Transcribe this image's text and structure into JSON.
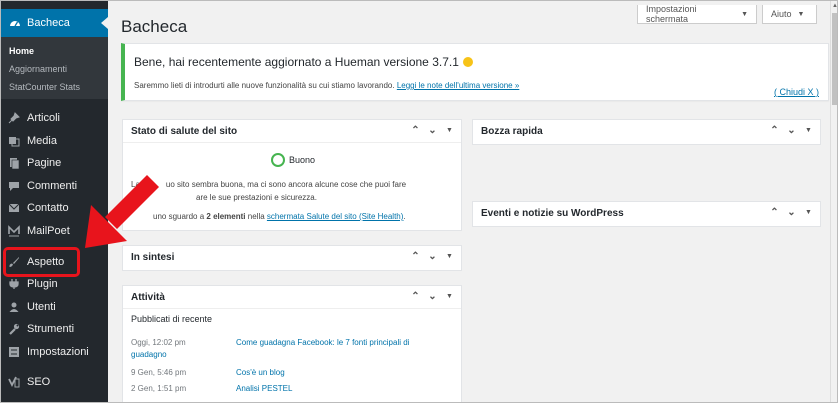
{
  "sidebar": {
    "active": {
      "label": "Bacheca",
      "icon": "dashboard-icon"
    },
    "submenu": [
      "Home",
      "Aggiornamenti",
      "StatCounter Stats"
    ],
    "items": [
      {
        "label": "Articoli",
        "icon": "pin-icon"
      },
      {
        "label": "Media",
        "icon": "media-icon"
      },
      {
        "label": "Pagine",
        "icon": "page-icon"
      },
      {
        "label": "Commenti",
        "icon": "comment-icon"
      },
      {
        "label": "Contatto",
        "icon": "mail-icon"
      },
      {
        "label": "MailPoet",
        "icon": "mailpoet-icon"
      },
      {
        "label": "Aspetto",
        "icon": "brush-icon"
      },
      {
        "label": "Plugin",
        "icon": "plugin-icon"
      },
      {
        "label": "Utenti",
        "icon": "users-icon"
      },
      {
        "label": "Strumenti",
        "icon": "wrench-icon"
      },
      {
        "label": "Impostazioni",
        "icon": "settings-icon"
      },
      {
        "label": "SEO",
        "icon": "yoast-icon"
      }
    ]
  },
  "header": {
    "title": "Bacheca",
    "screen_options": "Impostazioni schermata",
    "help": "Aiuto"
  },
  "notice": {
    "title": "Bene, hai recentemente aggiornato a Hueman versione 3.7.1",
    "text": "Saremmo lieti di introdurti alle nuove funzionalità su cui stiamo lavorando.",
    "link": "Leggi le note dell'ultima versione »",
    "dismiss": "( Chiudi X )"
  },
  "health": {
    "title": "Stato di salute del sito",
    "status": "Buono",
    "line1a": "La",
    "line1b": "uo sito sembra buona, ma ci sono ancora alcune cose che puoi fare",
    "line2": "are le sue prestazioni e sicurezza.",
    "line3a": "uno sguardo a",
    "line3b": "2 elementi",
    "line3c": "nella",
    "line3link": "schermata Salute del sito (Site Health)",
    "line3end": "."
  },
  "glance": {
    "title": "In sintesi"
  },
  "activity": {
    "title": "Attività",
    "subtitle": "Pubblicati di recente",
    "rows": [
      {
        "date": "Oggi, 12:02 pm",
        "title": "Come guadagna Facebook: le 7 fonti principali di",
        "title2": "guadagno"
      },
      {
        "date": "9 Gen, 5:46 pm",
        "title": "Cos'è un blog"
      },
      {
        "date": "2 Gen, 1:51 pm",
        "title": "Analisi PESTEL"
      }
    ]
  },
  "draft": {
    "title": "Bozza rapida"
  },
  "events": {
    "title": "Eventi e notizie su WordPress"
  },
  "colors": {
    "accent": "#0073aa",
    "success": "#46b450",
    "annotation": "#e8141c",
    "sidebar": "#23282d"
  }
}
